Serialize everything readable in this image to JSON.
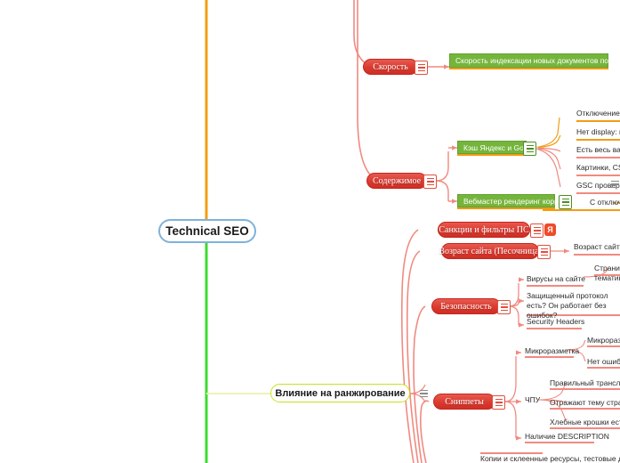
{
  "app": {
    "type": "mindmap",
    "title": "Technical SEO mind map"
  },
  "colors": {
    "root_border": "#7fb2d9",
    "lime_border": "#c8e020",
    "pill_red": "#d93b30",
    "green_box": "#75b53c",
    "orange_line": "#f39c12",
    "green_line": "#3ddb2f",
    "lime_line": "#eef3b8",
    "red_line": "#f08a80",
    "yandex_orange": "#f04a27"
  },
  "root": {
    "label": "Technical SEO"
  },
  "lime_node": {
    "label": "Влияние на ранжирование"
  },
  "branches": [
    {
      "id": "speed",
      "label": "Скорость",
      "children": [
        {
          "label": "Скорость индексации новых документов по Вебмастеру",
          "style": "green-box",
          "underline": "#f39c12"
        }
      ]
    },
    {
      "id": "content",
      "label": "Содержимое",
      "children": [
        {
          "label": "Кэш Яндекс и Google",
          "style": "green-box",
          "underline": "#f39c12",
          "children": [
            {
              "label": "Отключение JS в браузере",
              "underline": "#f39c12"
            },
            {
              "label": "Нет display: none?",
              "underline": "#f39c12"
            },
            {
              "label": "Есть весь важный контент",
              "underline": "#f08a80"
            },
            {
              "label": "Картинки, CSS, JS не запрещены",
              "underline": "#f08a80"
            },
            {
              "label": "GSC проверка URL?",
              "underline": "#f08a80"
            }
          ]
        },
        {
          "label": "Вебмастер рендеринг корректный",
          "style": "green-box",
          "underline": "#f39c12",
          "children": [
            {
              "label": "С отключенным",
              "underline": "#f39c12"
            }
          ]
        }
      ]
    },
    {
      "id": "sanctions",
      "label": "Санкции и фильтры ПС",
      "badge": "Я",
      "children": []
    },
    {
      "id": "age",
      "label": "Возраст сайта (Песочница)",
      "children": [
        {
          "label": "Возраст сайта бо",
          "underline": "#f08a80"
        }
      ]
    },
    {
      "id": "security",
      "label": "Безопасность",
      "children": [
        {
          "label": "Вирусы на сайте",
          "underline": "#f08a80"
        },
        {
          "label": "Защищенный протокол есть? Он работает без ошибок?",
          "underline": "#f08a80"
        },
        {
          "label": "Security Headers",
          "underline": "#f08a80"
        },
        {
          "label": "Страницы тематик",
          "underline": "#f08a80",
          "far": true
        }
      ]
    },
    {
      "id": "snippets",
      "label": "Сниппеты",
      "children": [
        {
          "label": "Микроразметка",
          "underline": "#f08a80",
          "children": [
            {
              "label": "Микроразм",
              "underline": "#f08a80"
            },
            {
              "label": "Нет ошибок",
              "underline": "#f08a80"
            }
          ]
        },
        {
          "label": "ЧПУ",
          "children": [
            {
              "label": "Правильный транслит?",
              "underline": "#f08a80"
            },
            {
              "label": "Отражают тему страниц",
              "underline": "#f08a80"
            },
            {
              "label": "Хлебные крошки есть",
              "underline": "#f08a80"
            }
          ]
        },
        {
          "label": "Наличие DESCRIPTION",
          "underline": "#f08a80"
        }
      ]
    },
    {
      "id": "duplicates",
      "label": "Копии и склеенные ресурсы, тестовые д",
      "style": "text-only"
    }
  ],
  "icons": {
    "note": "note-icon",
    "yandex": "yandex-icon"
  }
}
